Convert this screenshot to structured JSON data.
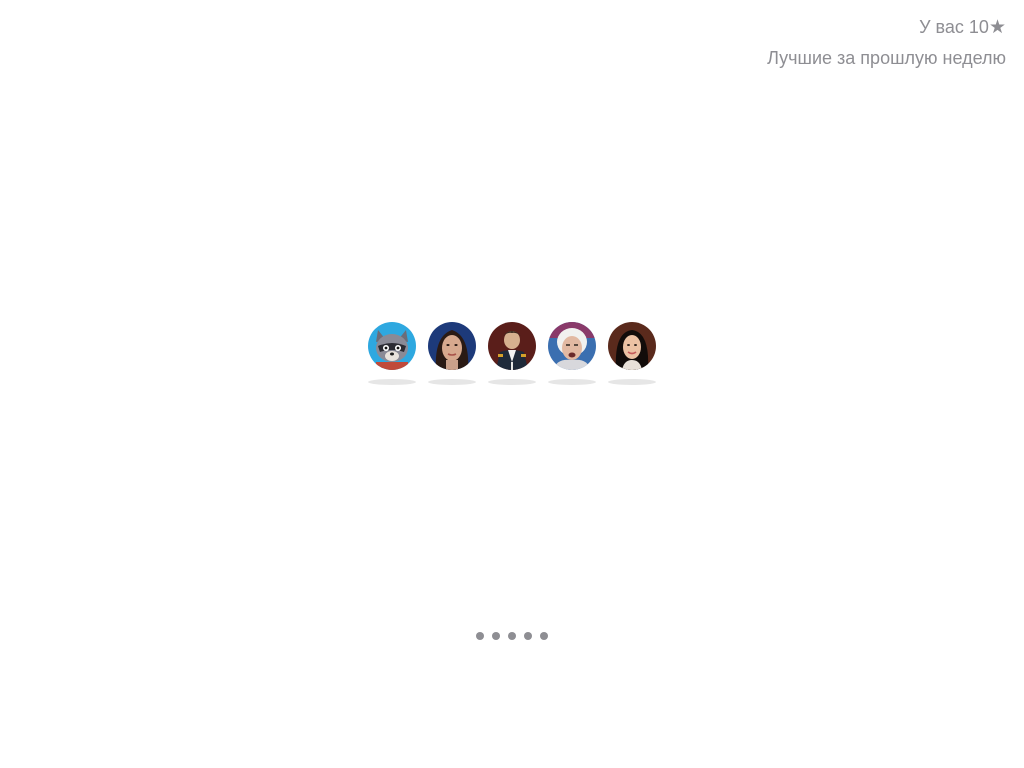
{
  "header": {
    "stars_text": "У вас 10",
    "star_glyph": "★",
    "best_last_week_link": "Лучшие за прошлую неделю",
    "text_color": "#8e8e93"
  },
  "leaderboard": {
    "avatars": [
      {
        "icon": "cartoon-raccoon-avatar-icon",
        "bg": "#2ea8e0"
      },
      {
        "icon": "woman-portrait-avatar-icon",
        "bg": "#1d3a7a"
      },
      {
        "icon": "napoleon-portrait-avatar-icon",
        "bg": "#5a1e1a"
      },
      {
        "icon": "old-man-portrait-avatar-icon",
        "bg": "#3b6fb0"
      },
      {
        "icon": "woman-portrait-avatar-icon",
        "bg": "#5a2a1c"
      }
    ]
  },
  "pager": {
    "count": 5,
    "dot_color": "#8e8e93"
  }
}
